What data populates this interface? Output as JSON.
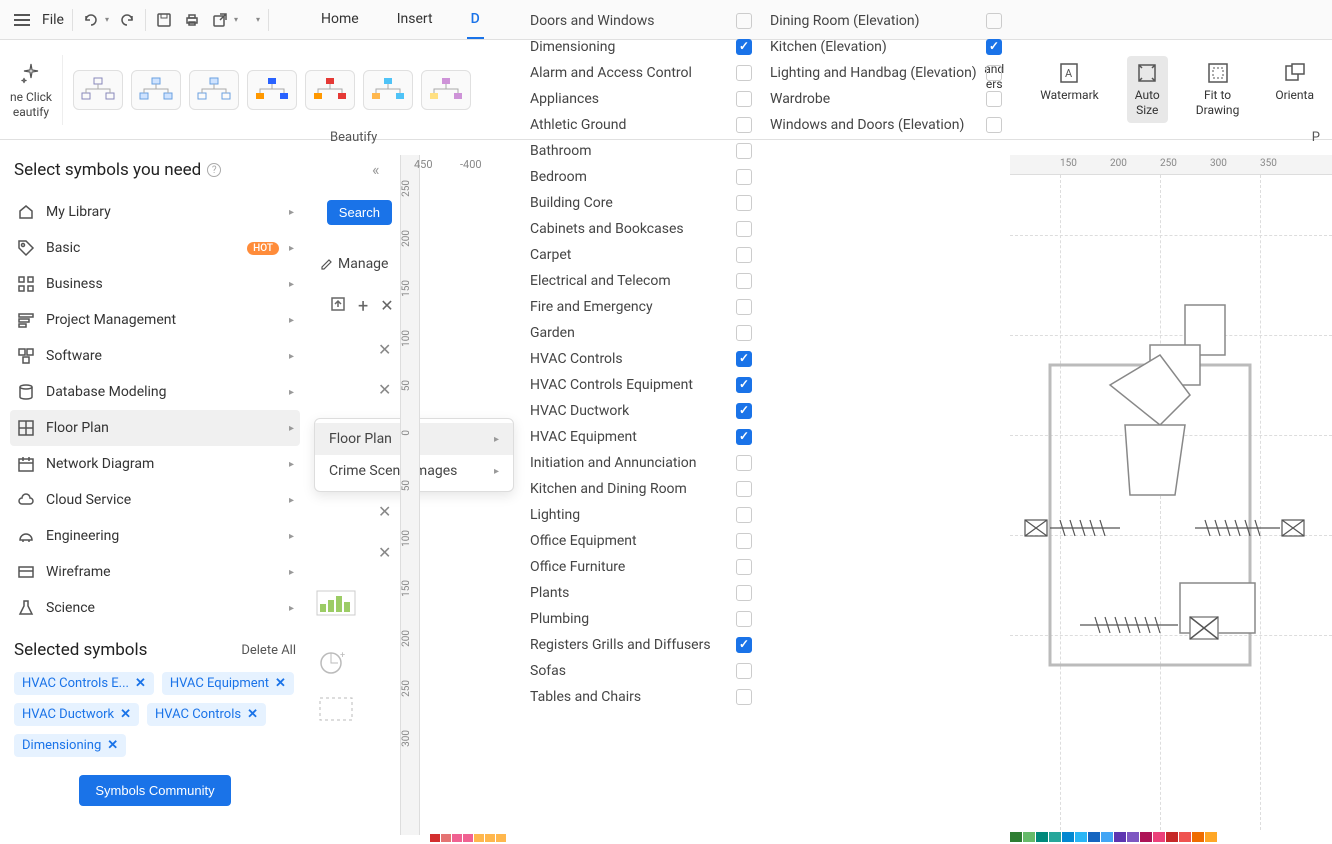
{
  "toolbar": {
    "file_label": "File",
    "tabs": [
      "Home",
      "Insert",
      "D"
    ],
    "active_tab_index": 2
  },
  "ribbon": {
    "one_click_label": "ne Click\neautify",
    "beautify_label": "Beautify",
    "right_items": [
      {
        "label": "and\ners"
      },
      {
        "label": "Watermark"
      },
      {
        "label": "Auto\nSize",
        "highlighted": true
      },
      {
        "label": "Fit to\nDrawing"
      },
      {
        "label": "Orienta"
      }
    ],
    "page_partial": "P"
  },
  "left_panel": {
    "title": "Select symbols you need",
    "items": [
      {
        "label": "My Library",
        "icon": "home"
      },
      {
        "label": "Basic",
        "icon": "tag",
        "hot": true
      },
      {
        "label": "Business",
        "icon": "grid"
      },
      {
        "label": "Project Management",
        "icon": "bars"
      },
      {
        "label": "Software",
        "icon": "squares"
      },
      {
        "label": "Database Modeling",
        "icon": "db"
      },
      {
        "label": "Floor Plan",
        "icon": "floor",
        "hovered": true
      },
      {
        "label": "Network Diagram",
        "icon": "calendar"
      },
      {
        "label": "Cloud Service",
        "icon": "cloud"
      },
      {
        "label": "Engineering",
        "icon": "helmet"
      },
      {
        "label": "Wireframe",
        "icon": "wire"
      },
      {
        "label": "Science",
        "icon": "flask"
      }
    ],
    "selected_title": "Selected symbols",
    "delete_all": "Delete All",
    "tags": [
      "HVAC Controls E...",
      "HVAC Equipment",
      "HVAC Ductwork",
      "HVAC Controls",
      "Dimensioning"
    ],
    "community_btn": "Symbols Community"
  },
  "search": {
    "button": "Search",
    "manage": "Manage"
  },
  "submenu": {
    "items": [
      {
        "label": "Floor Plan",
        "hovered": true
      },
      {
        "label": "Crime Scene Images"
      }
    ]
  },
  "checklist_col1": [
    {
      "label": "Doors and Windows",
      "checked": false
    },
    {
      "label": "Dimensioning",
      "checked": true
    },
    {
      "label": "Alarm and Access Control",
      "checked": false
    },
    {
      "label": "Appliances",
      "checked": false
    },
    {
      "label": "Athletic Ground",
      "checked": false
    },
    {
      "label": "Bathroom",
      "checked": false
    },
    {
      "label": "Bedroom",
      "checked": false
    },
    {
      "label": "Building Core",
      "checked": false
    },
    {
      "label": "Cabinets and Bookcases",
      "checked": false
    },
    {
      "label": "Carpet",
      "checked": false
    },
    {
      "label": "Electrical and Telecom",
      "checked": false
    },
    {
      "label": "Fire and Emergency",
      "checked": false
    },
    {
      "label": "Garden",
      "checked": false
    },
    {
      "label": "HVAC Controls",
      "checked": true
    },
    {
      "label": "HVAC Controls Equipment",
      "checked": true
    },
    {
      "label": "HVAC Ductwork",
      "checked": true
    },
    {
      "label": "HVAC Equipment",
      "checked": true
    },
    {
      "label": "Initiation and Annunciation",
      "checked": false
    },
    {
      "label": "Kitchen and Dining Room",
      "checked": false
    },
    {
      "label": "Lighting",
      "checked": false
    },
    {
      "label": "Office Equipment",
      "checked": false
    },
    {
      "label": "Office Furniture",
      "checked": false
    },
    {
      "label": "Plants",
      "checked": false
    },
    {
      "label": "Plumbing",
      "checked": false
    },
    {
      "label": "Registers Grills and Diffusers",
      "checked": true
    },
    {
      "label": "Sofas",
      "checked": false
    },
    {
      "label": "Tables and Chairs",
      "checked": false
    }
  ],
  "checklist_col2": [
    {
      "label": "Dining Room (Elevation)",
      "checked": false
    },
    {
      "label": "Kitchen (Elevation)",
      "checked": true
    },
    {
      "label": "Lighting and Handbag (Elevation)",
      "checked": false
    },
    {
      "label": "Wardrobe",
      "checked": false
    },
    {
      "label": "Windows and Doors (Elevation)",
      "checked": false
    }
  ],
  "ruler": {
    "v_ticks": [
      {
        "val": "250",
        "pos": 25
      },
      {
        "val": "200",
        "pos": 75
      },
      {
        "val": "150",
        "pos": 125
      },
      {
        "val": "100",
        "pos": 175
      },
      {
        "val": "50",
        "pos": 225
      },
      {
        "val": "0",
        "pos": 275
      },
      {
        "val": "50",
        "pos": 325
      },
      {
        "val": "100",
        "pos": 375
      },
      {
        "val": "150",
        "pos": 425
      },
      {
        "val": "200",
        "pos": 475
      },
      {
        "val": "250",
        "pos": 525
      },
      {
        "val": "300",
        "pos": 575
      }
    ],
    "v_top_labels": [
      "450",
      "-400"
    ],
    "h_ticks": [
      {
        "val": "150",
        "pos": 50
      },
      {
        "val": "200",
        "pos": 100
      },
      {
        "val": "250",
        "pos": 150
      },
      {
        "val": "300",
        "pos": 200
      },
      {
        "val": "350",
        "pos": 250
      }
    ]
  },
  "colorbar": [
    "#2e7d32",
    "#66bb6a",
    "#00897b",
    "#26a69a",
    "#0288d1",
    "#29b6f6",
    "#1565c0",
    "#42a5f5",
    "#5e35b1",
    "#7e57c2",
    "#ad1457",
    "#ec407a",
    "#c62828",
    "#ef5350",
    "#ef6c00",
    "#ffa726"
  ],
  "colorbar2": [
    "#d32f2f",
    "#e57373",
    "#f06292",
    "#f06292",
    "#ffb74d",
    "#ffb74d",
    "#ffb74d"
  ]
}
